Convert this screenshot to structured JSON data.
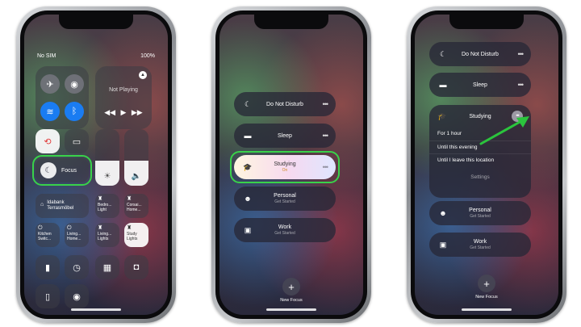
{
  "status": {
    "carrier": "No SIM",
    "battery": "100%"
  },
  "control_center": {
    "now_playing": "Not Playing",
    "focus_label": "Focus",
    "focus_highlight_color": "#39d24a",
    "tiles": [
      {
        "label": "Idabank Terrasmöbel",
        "icon": "home-icon"
      },
      {
        "label": "Bedro... Light",
        "icon": "lamp-icon"
      },
      {
        "label": "Corsai... Home...",
        "icon": "lamp-icon"
      },
      {
        "label": "Kitchen Switc...",
        "icon": "switch-icon"
      },
      {
        "label": "Living... Home...",
        "icon": "switch-icon"
      },
      {
        "label": "Living... Lights",
        "icon": "lamp-icon"
      },
      {
        "label": "Study Lights",
        "icon": "lamp-icon"
      }
    ]
  },
  "focus_list": {
    "items": [
      {
        "name": "Do Not Disturb",
        "sub": "",
        "icon": "moon-icon"
      },
      {
        "name": "Sleep",
        "sub": "",
        "icon": "bed-icon"
      },
      {
        "name": "Studying",
        "sub": "On",
        "icon": "graduation-cap-icon"
      },
      {
        "name": "Personal",
        "sub": "Get Started",
        "icon": "person-icon"
      },
      {
        "name": "Work",
        "sub": "Get Started",
        "icon": "badge-icon"
      }
    ],
    "new_focus": "New Focus"
  },
  "expanded": {
    "title": "Studying",
    "options": [
      "For 1 hour",
      "Until this evening",
      "Until I leave this location"
    ],
    "settings": "Settings",
    "arrow_color": "#2bc43d"
  }
}
